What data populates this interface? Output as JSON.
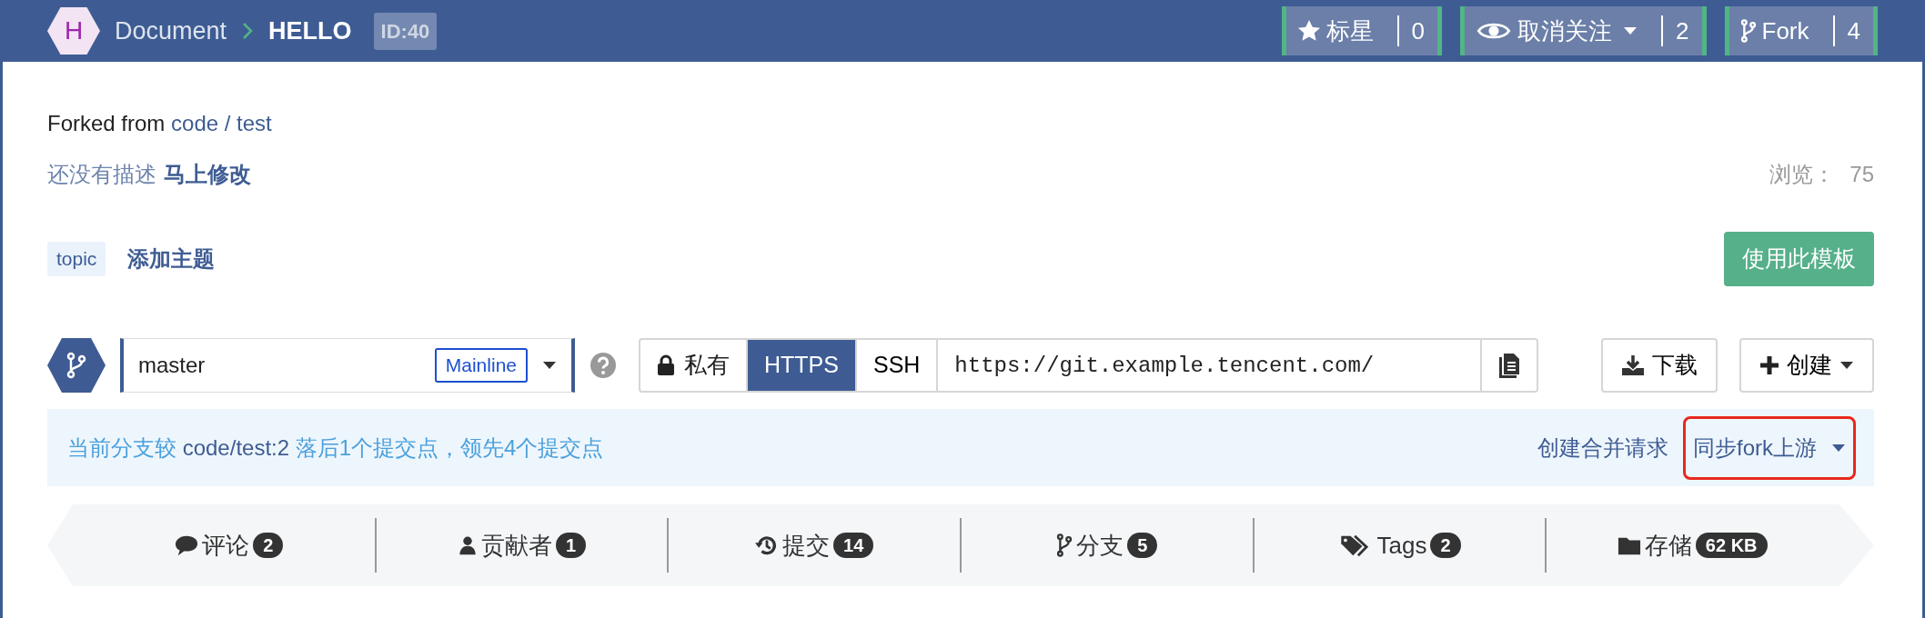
{
  "header": {
    "logo_letter": "H",
    "breadcrumb": "Document",
    "title": "HELLO",
    "id_badge": "ID:40"
  },
  "actions": [
    {
      "kind": "star",
      "label": "标星",
      "count": "0",
      "dropdown": false
    },
    {
      "kind": "watch",
      "label": "取消关注",
      "count": "2",
      "dropdown": true
    },
    {
      "kind": "fork",
      "label": "Fork",
      "count": "4",
      "dropdown": false
    }
  ],
  "repo": {
    "forked_from_label": "Forked from",
    "forked_from_link": "code / test",
    "description": "还没有描述",
    "edit_link": "马上修改",
    "views_label": "浏览：",
    "views": "75",
    "topic": "topic",
    "add_topic": "添加主题",
    "template_button": "使用此模板"
  },
  "branch": {
    "name": "master",
    "badge": "Mainline"
  },
  "clone": {
    "visibility": "私有",
    "protocols": [
      {
        "label": "HTTPS",
        "selected": true
      },
      {
        "label": "SSH",
        "selected": false
      }
    ],
    "url": "https://git.example.tencent.com/"
  },
  "download_button": "下载",
  "create_button": "创建",
  "compare": {
    "prefix": "当前分支较",
    "ref": "code/test:2",
    "status": "落后1个提交点，领先4个提交点",
    "create_merge_request": "创建合并请求",
    "sync": "同步fork上游",
    "sync_highlighted": true
  },
  "stats": [
    {
      "kind": "comment",
      "label": "评论",
      "count": "2"
    },
    {
      "kind": "user",
      "label": "贡献者",
      "count": "1"
    },
    {
      "kind": "history",
      "label": "提交",
      "count": "14"
    },
    {
      "kind": "branch",
      "label": "分支",
      "count": "5"
    },
    {
      "kind": "tags",
      "label": "Tags",
      "count": "2"
    },
    {
      "kind": "folder",
      "label": "存储",
      "count": "62 KB"
    }
  ]
}
